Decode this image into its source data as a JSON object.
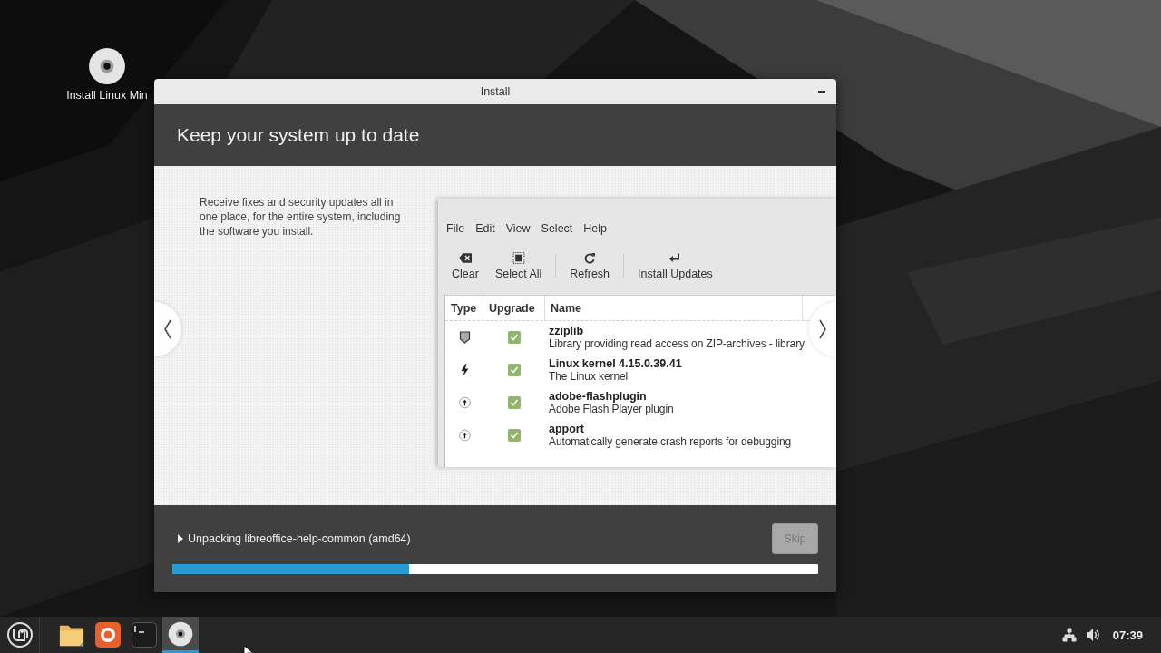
{
  "desktop": {
    "icons": [
      {
        "label": "Install Linux Min"
      }
    ]
  },
  "window": {
    "title": "Install",
    "heading": "Keep your system up to date",
    "slide": {
      "text": "Receive fixes and security updates all in one place, for the entire system, including the software you install.",
      "screenshot": {
        "menu": [
          "File",
          "Edit",
          "View",
          "Select",
          "Help"
        ],
        "toolbar": [
          {
            "label": "Clear",
            "kind": "clear"
          },
          {
            "label": "Select All",
            "kind": "select-all"
          },
          {
            "label": "Refresh",
            "kind": "refresh"
          },
          {
            "label": "Install Updates",
            "kind": "install"
          }
        ],
        "columns": [
          "Type",
          "Upgrade",
          "Name"
        ],
        "rows": [
          {
            "kind": "security",
            "checked": true,
            "name": "zziplib",
            "description": "Library providing read access on ZIP-archives - library"
          },
          {
            "kind": "kernel",
            "checked": true,
            "name": "Linux kernel 4.15.0.39.41",
            "description": "The Linux kernel"
          },
          {
            "kind": "package",
            "checked": true,
            "name": "adobe-flashplugin",
            "description": "Adobe Flash Player plugin"
          },
          {
            "kind": "package",
            "checked": true,
            "name": "apport",
            "description": "Automatically generate crash reports for debugging"
          }
        ]
      }
    },
    "status": "Unpacking libreoffice-help-common (amd64)",
    "skip": {
      "label": "Skip",
      "disabled": true
    },
    "progress": {
      "level": 0.367
    }
  },
  "taskbar": {
    "launchers": [
      {
        "kind": "files",
        "selected": false
      },
      {
        "kind": "browser",
        "selected": false
      },
      {
        "kind": "terminal",
        "selected": false
      },
      {
        "kind": "installer",
        "selected": true
      }
    ],
    "clock": "07:39"
  }
}
